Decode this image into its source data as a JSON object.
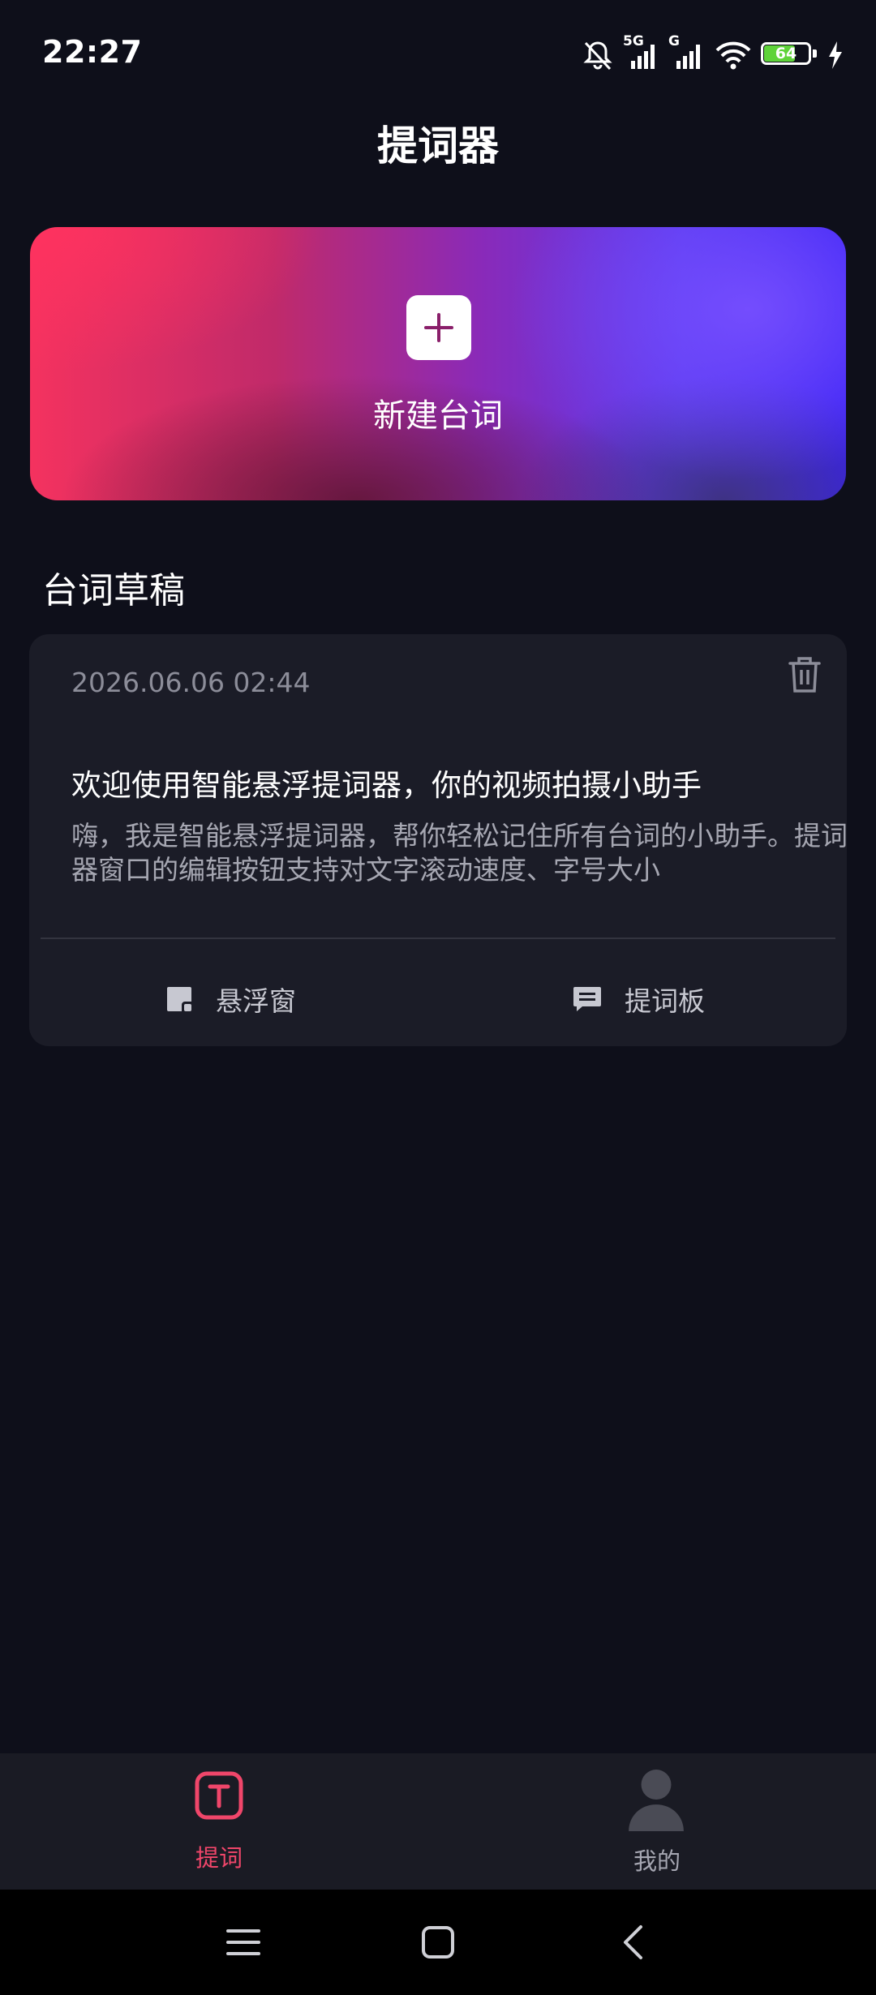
{
  "status_bar": {
    "time": "22:27",
    "network_primary": "5G",
    "network_secondary": "G",
    "battery": "64",
    "icons": [
      "mute-icon",
      "signal-icon",
      "signal-icon",
      "wifi-icon",
      "battery-icon",
      "charging-icon"
    ]
  },
  "header": {
    "title": "提词器"
  },
  "new_card": {
    "label": "新建台词",
    "icon": "plus-icon",
    "colors": {
      "start": "#f4325f",
      "middle": "#8a2ab8",
      "end": "#3a22f5"
    }
  },
  "drafts": {
    "section_title": "台词草稿",
    "items": [
      {
        "date": "2026.06.06 02:44",
        "title": "欢迎使用智能悬浮提词器，你的视频拍摄小助手",
        "body": "嗨，我是智能悬浮提词器，帮你轻松记住所有台词的小助手。提词器窗口的编辑按钮支持对文字滚动速度、字号大小",
        "actions": {
          "float_label": "悬浮窗",
          "board_label": "提词板"
        }
      }
    ]
  },
  "bottom_nav": {
    "items": [
      {
        "label": "提词",
        "icon": "t-icon",
        "active": true
      },
      {
        "label": "我的",
        "icon": "person-icon",
        "active": false
      }
    ],
    "active_color": "#f0466a"
  },
  "system_nav": {
    "icons": [
      "menu-icon",
      "home-icon",
      "back-icon"
    ]
  }
}
